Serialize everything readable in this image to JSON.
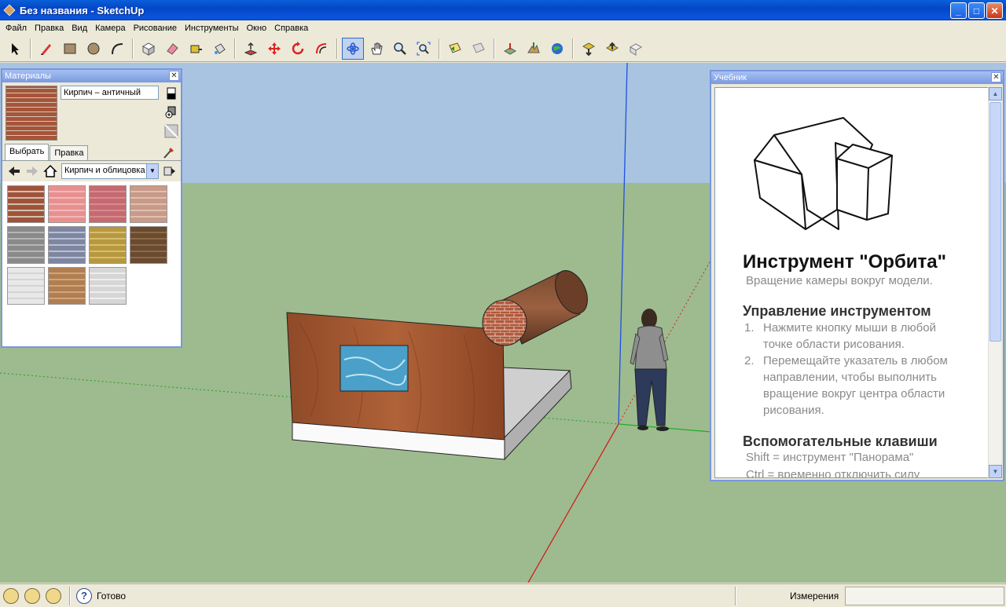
{
  "window": {
    "title": "Без названия - SketchUp",
    "buttons": {
      "minimize": "_",
      "maximize": "□",
      "close": "✕"
    }
  },
  "menu": [
    "Файл",
    "Правка",
    "Вид",
    "Камера",
    "Рисование",
    "Инструменты",
    "Окно",
    "Справка"
  ],
  "toolbar": {
    "tools": [
      {
        "name": "select-tool",
        "icon": "arrow-icon"
      },
      {
        "sep": true
      },
      {
        "name": "pencil-tool",
        "icon": "pencil-icon"
      },
      {
        "name": "rectangle-tool",
        "icon": "rectangle-icon"
      },
      {
        "name": "circle-tool",
        "icon": "circle-icon"
      },
      {
        "name": "arc-tool",
        "icon": "arc-icon"
      },
      {
        "sep": true
      },
      {
        "name": "make-component-tool",
        "icon": "component-icon"
      },
      {
        "name": "eraser-tool",
        "icon": "eraser-icon"
      },
      {
        "name": "tape-measure-tool",
        "icon": "tape-icon"
      },
      {
        "name": "paint-bucket-tool",
        "icon": "bucket-icon"
      },
      {
        "sep": true
      },
      {
        "name": "push-pull-tool",
        "icon": "pushpull-icon"
      },
      {
        "name": "move-tool",
        "icon": "move-icon"
      },
      {
        "name": "rotate-tool",
        "icon": "rotate-icon"
      },
      {
        "name": "offset-tool",
        "icon": "offset-icon"
      },
      {
        "sep": true
      },
      {
        "name": "orbit-tool",
        "icon": "orbit-icon",
        "active": true
      },
      {
        "name": "pan-tool",
        "icon": "hand-icon"
      },
      {
        "name": "zoom-tool",
        "icon": "zoom-icon"
      },
      {
        "name": "zoom-extents-tool",
        "icon": "zoom-extents-icon"
      },
      {
        "sep": true
      },
      {
        "name": "previous-view-tool",
        "icon": "prev-view-icon"
      },
      {
        "name": "next-view-tool",
        "icon": "next-view-icon"
      },
      {
        "sep": true
      },
      {
        "name": "add-location-tool",
        "icon": "location-icon"
      },
      {
        "name": "toggle-terrain-tool",
        "icon": "terrain-icon"
      },
      {
        "name": "google-earth-tool",
        "icon": "earth-icon"
      },
      {
        "sep": true
      },
      {
        "name": "get-models-tool",
        "icon": "get-models-icon"
      },
      {
        "name": "share-model-tool",
        "icon": "share-model-icon"
      },
      {
        "name": "share-component-tool",
        "icon": "share-component-icon"
      }
    ]
  },
  "materials": {
    "title": "Материалы",
    "close": "✕",
    "current_name": "Кирпич – античный",
    "tabs": [
      "Выбрать",
      "Правка"
    ],
    "library": "Кирпич и облицовка",
    "swatch_colors": [
      [
        "#a0533a",
        "#d2c1ae"
      ],
      [
        "#e89090",
        "#f3b8b8"
      ],
      [
        "#c46a70",
        "#d88a8e"
      ],
      [
        "#c89a88",
        "#e0c0b0"
      ],
      [
        "#8a8a8a",
        "#b5b5b5"
      ],
      [
        "#7f86a0",
        "#b8c0d6"
      ],
      [
        "#b8983e",
        "#d6be70"
      ],
      [
        "#6a4a30",
        "#8e6a45"
      ],
      [
        "#e8e8e8",
        "#d4d4d4"
      ],
      [
        "#b07e52",
        "#d2a578"
      ],
      [
        "#d6d6d6",
        "#eeeeee"
      ]
    ]
  },
  "tutor": {
    "title": "Учебник",
    "close": "✕",
    "heading": "Инструмент \"Орбита\"",
    "subtitle": "Вращение камеры вокруг модели.",
    "section1": "Управление инструментом",
    "steps": [
      {
        "num": "1.",
        "text": "Нажмите кнопку мыши в любой точке области рисования."
      },
      {
        "num": "2.",
        "text": "Перемещайте указатель в любом направлении, чтобы выполнить вращение вокруг центра области рисования."
      }
    ],
    "section2": "Вспомогательные клавиши",
    "keys": [
      "Shift = инструмент \"Панорама\"",
      "Ctrl = временно отключить силу"
    ],
    "scroll_up": "▲",
    "scroll_down": "▼"
  },
  "status": {
    "help_icon": "?",
    "text": "Готово",
    "measurements_label": "Измерения",
    "measurements_value": ""
  },
  "colors": {
    "sky": "#a8c4e0",
    "ground": "#9dbb8f",
    "wood": "#a0522d",
    "water": "#4aa0c8",
    "axis_blue": "#2050e0",
    "axis_green": "#20b020",
    "axis_red": "#d02020"
  }
}
